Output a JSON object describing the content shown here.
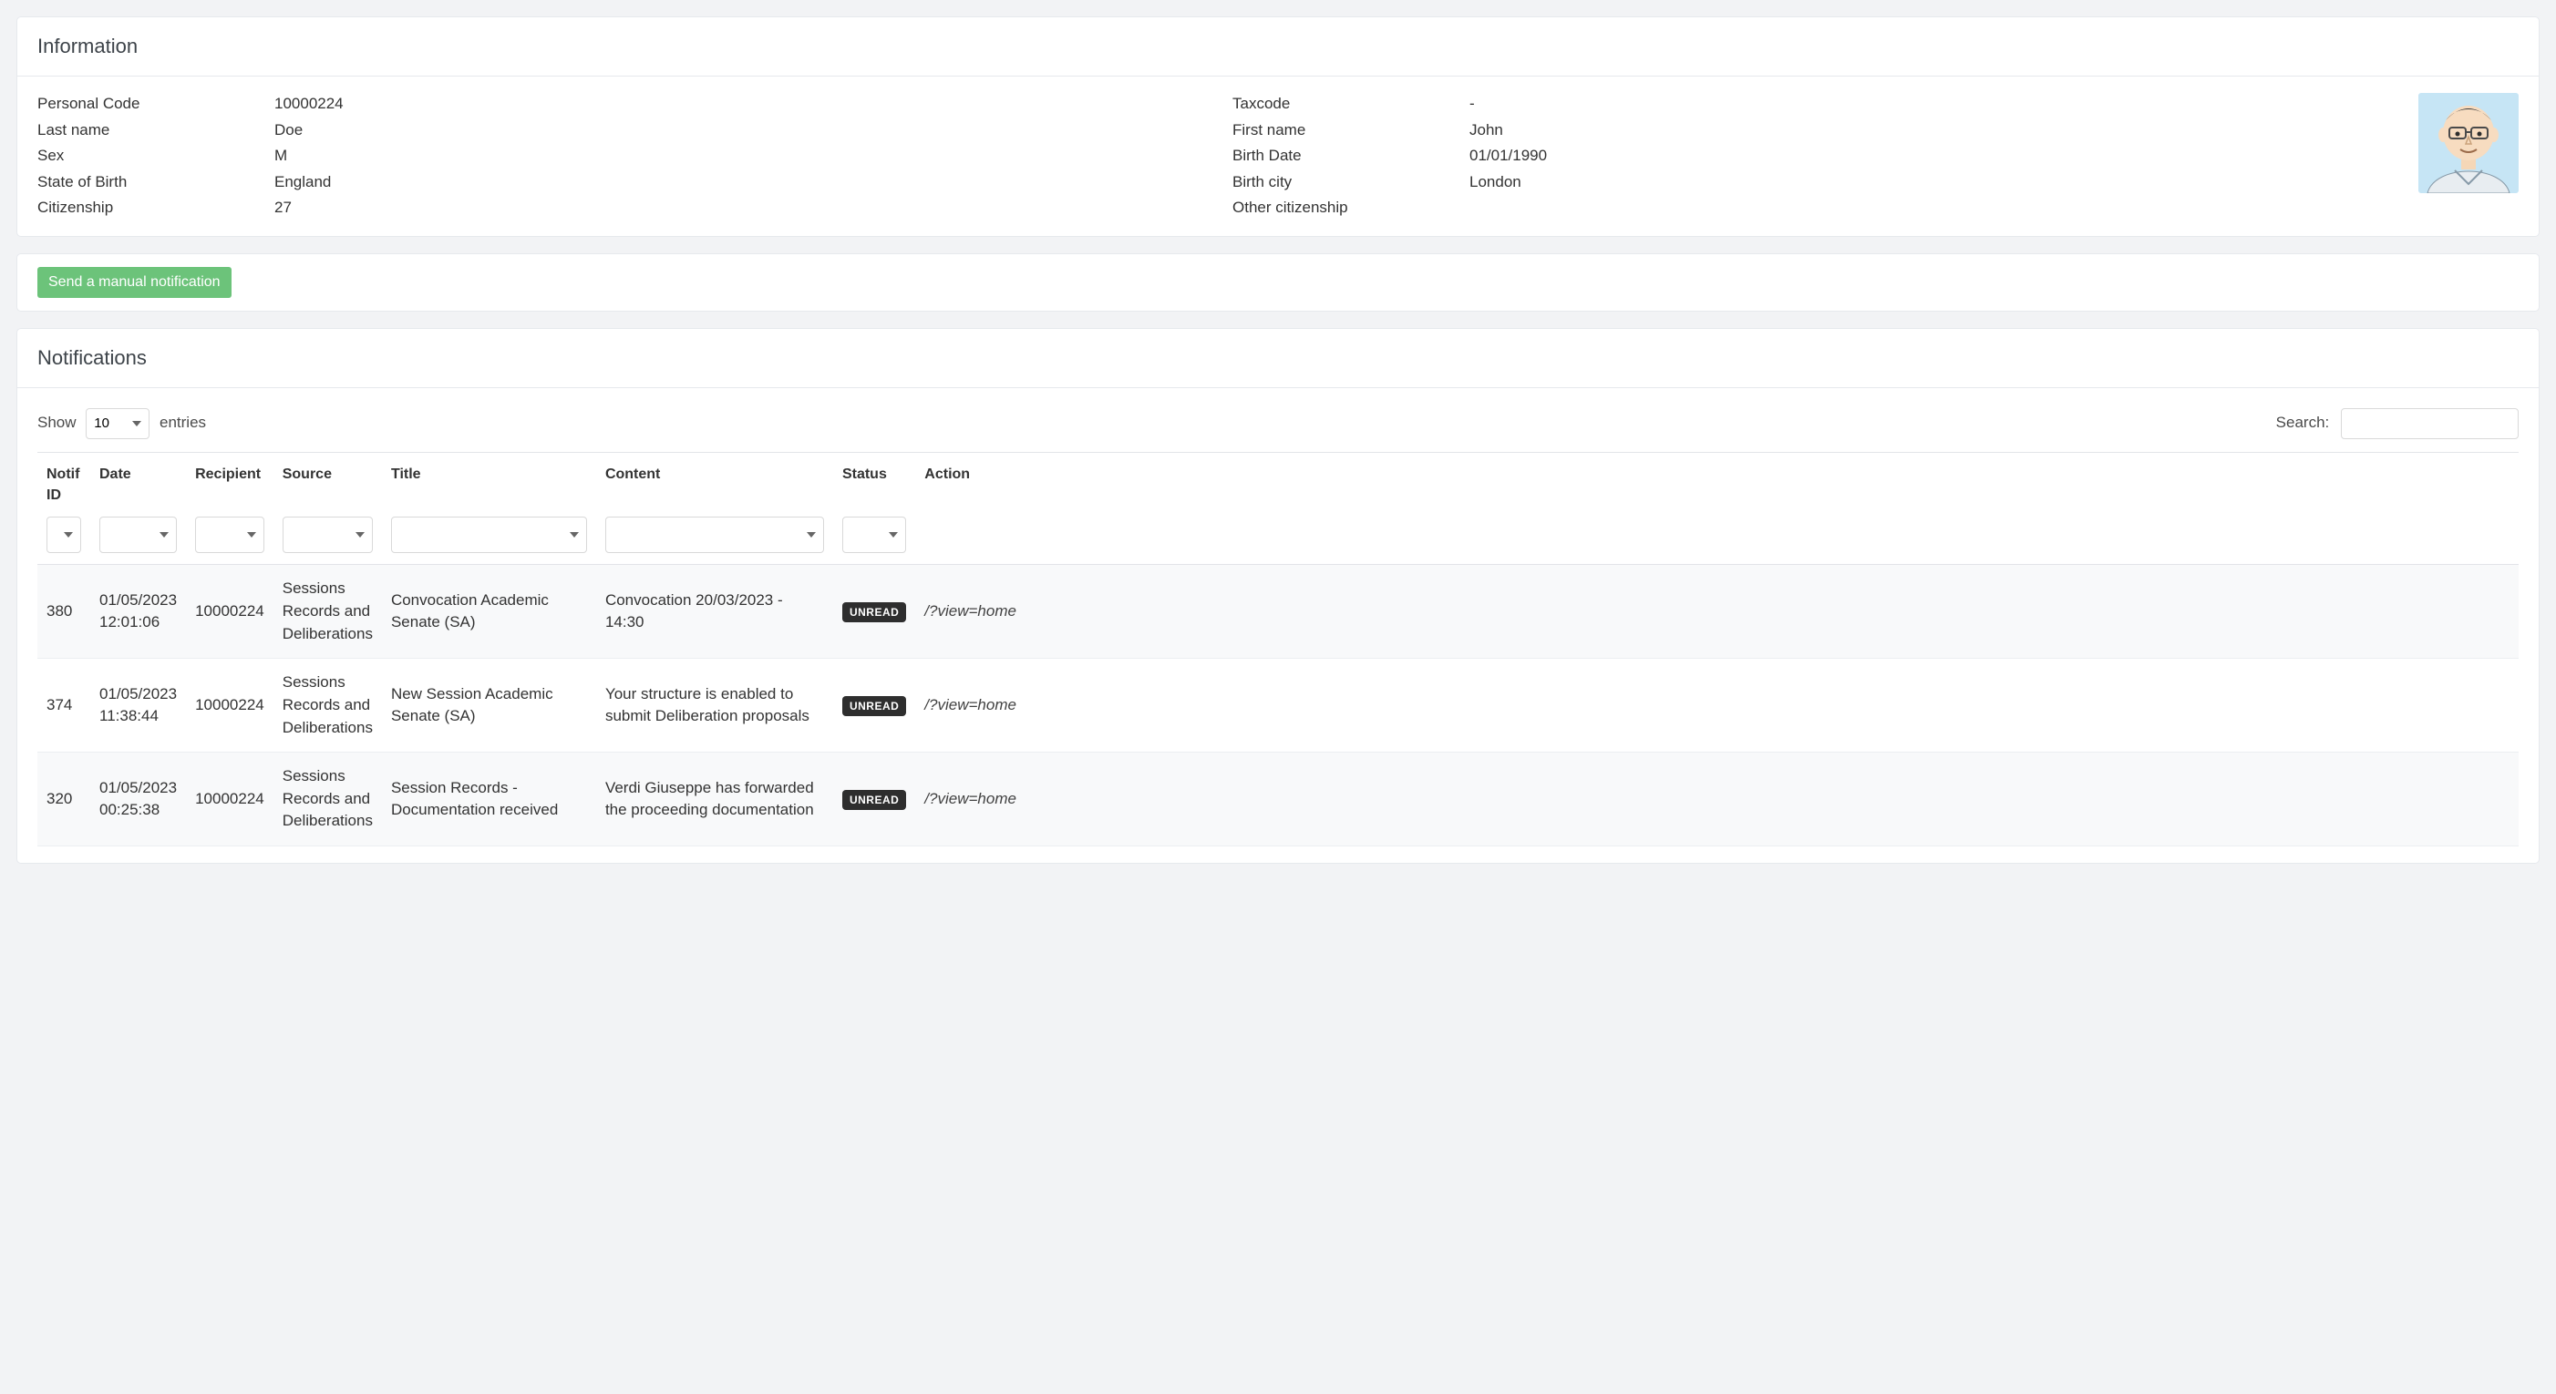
{
  "info_card": {
    "title": "Information",
    "left": [
      {
        "label": "Personal Code",
        "value": "10000224"
      },
      {
        "label": "Last name",
        "value": "Doe"
      },
      {
        "label": "Sex",
        "value": "M"
      },
      {
        "label": "State of Birth",
        "value": "England"
      },
      {
        "label": "Citizenship",
        "value": "27"
      }
    ],
    "right": [
      {
        "label": "Taxcode",
        "value": "-"
      },
      {
        "label": "First name",
        "value": "John"
      },
      {
        "label": "Birth Date",
        "value": "01/01/1990"
      },
      {
        "label": "Birth city",
        "value": "London"
      },
      {
        "label": "Other citizenship",
        "value": ""
      }
    ]
  },
  "send_button": "Send a manual notification",
  "notif_card": {
    "title": "Notifications",
    "show_label_pre": "Show",
    "show_value": "10",
    "show_label_post": "entries",
    "search_label": "Search:",
    "search_value": "",
    "columns": [
      "Notif ID",
      "Date",
      "Recipient",
      "Source",
      "Title",
      "Content",
      "Status",
      "Action"
    ],
    "status_unread": "UNREAD",
    "rows": [
      {
        "id": "380",
        "date": "01/05/2023 12:01:06",
        "recipient": "10000224",
        "source": "Sessions Records and Deliberations",
        "title": "Convocation Academic Senate (SA)",
        "content": "Convocation 20/03/2023 - 14:30",
        "status": "UNREAD",
        "action": "/?view=home"
      },
      {
        "id": "374",
        "date": "01/05/2023 11:38:44",
        "recipient": "10000224",
        "source": "Sessions Records and Deliberations",
        "title": "New Session Academic Senate (SA)",
        "content": "Your structure is enabled to submit Deliberation proposals",
        "status": "UNREAD",
        "action": "/?view=home"
      },
      {
        "id": "320",
        "date": "01/05/2023 00:25:38",
        "recipient": "10000224",
        "source": "Sessions Records and Deliberations",
        "title": "Session Records - Documentation received",
        "content": "Verdi Giuseppe has forwarded the proceeding documentation",
        "status": "UNREAD",
        "action": "/?view=home"
      }
    ]
  }
}
